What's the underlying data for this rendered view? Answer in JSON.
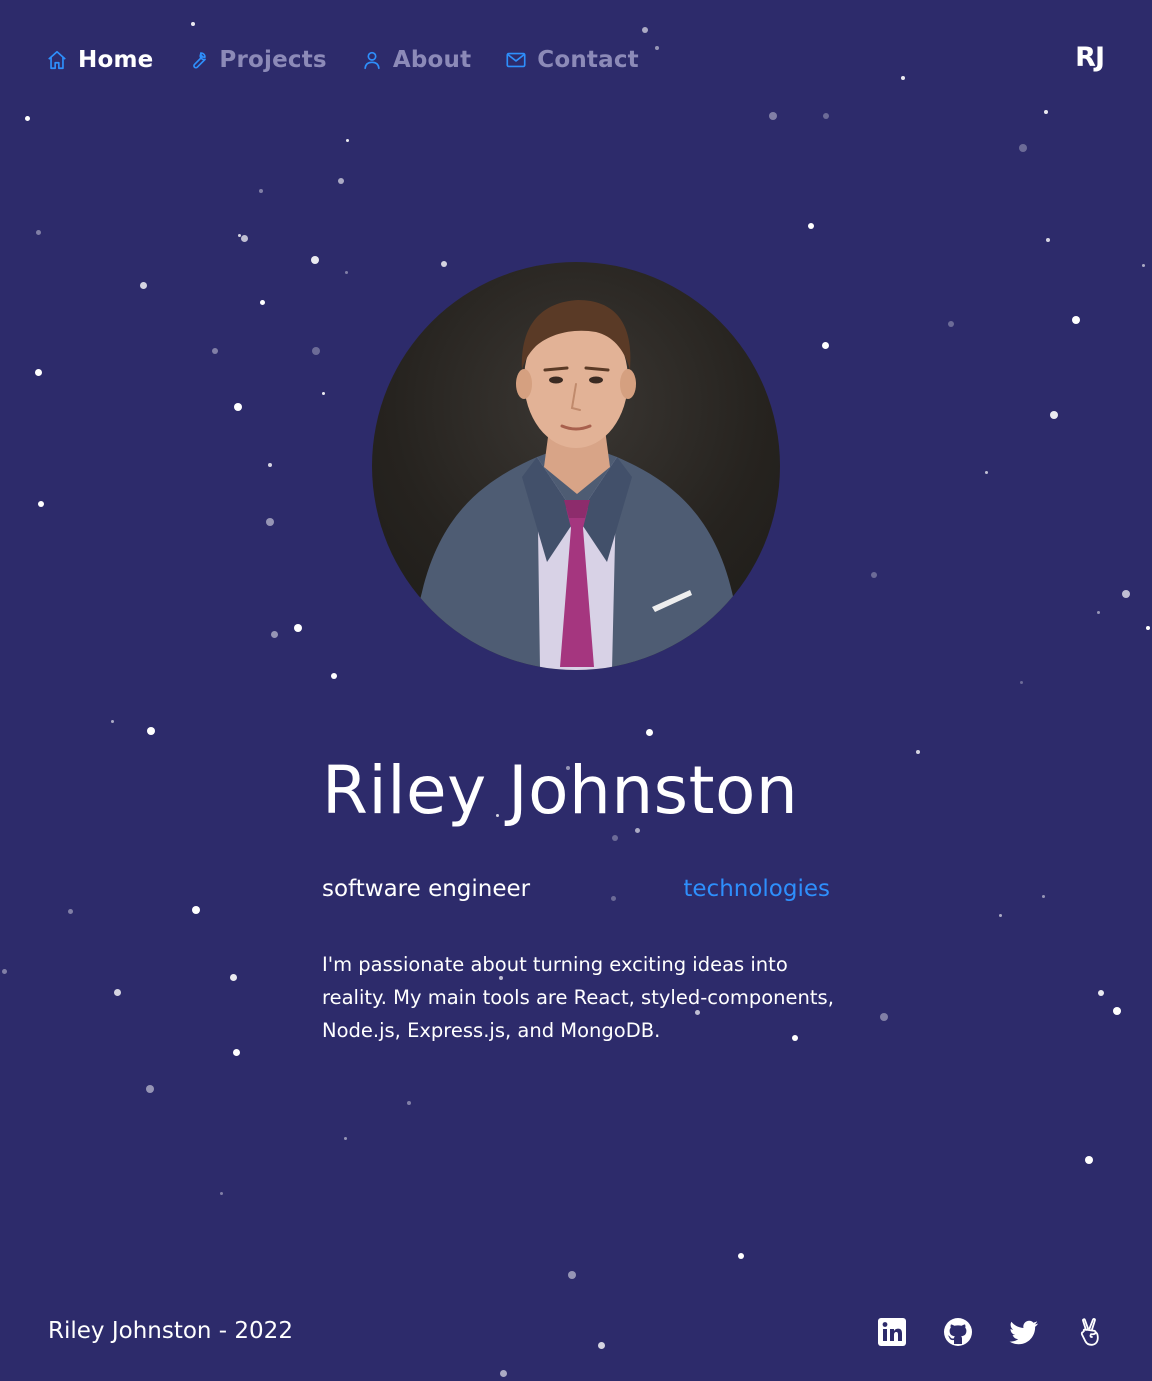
{
  "nav": {
    "items": [
      {
        "label": "Home",
        "icon": "home-icon",
        "active": true
      },
      {
        "label": "Projects",
        "icon": "wrench-icon",
        "active": false
      },
      {
        "label": "About",
        "icon": "user-icon",
        "active": false
      },
      {
        "label": "Contact",
        "icon": "mail-icon",
        "active": false
      }
    ],
    "logo": "RJ"
  },
  "hero": {
    "name": "Riley Johnston",
    "role": "software engineer",
    "technologies_link": "technologies",
    "bio": "I'm passionate about turning exciting ideas into reality. My main tools are React, styled-components, Node.js, Express.js, and MongoDB."
  },
  "footer": {
    "copyright": "Riley Johnston - 2022",
    "socials": [
      "linkedin-icon",
      "github-icon",
      "twitter-icon",
      "angellist-icon"
    ]
  },
  "colors": {
    "background": "#2d2b6b",
    "accent": "#2e8ffc",
    "nav_inactive": "#8c8ab8",
    "text": "#ffffff"
  }
}
